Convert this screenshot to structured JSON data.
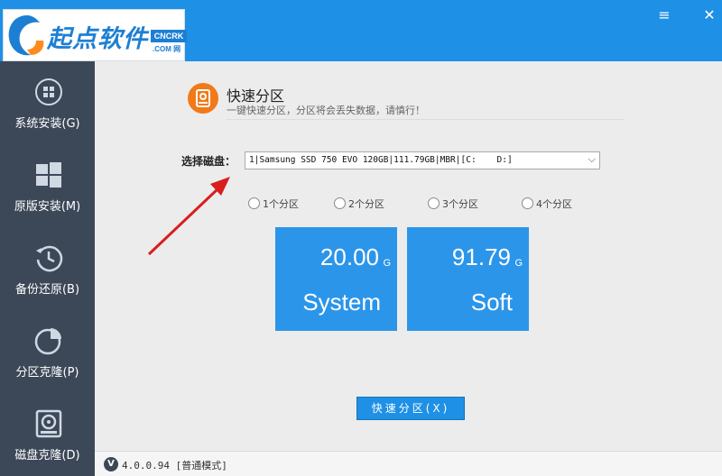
{
  "app": {
    "logo_text": "起点软件",
    "logo_badge": "CNCRK",
    "logo_sub": ".COM 网"
  },
  "window_controls": {
    "menu_icon": "≡",
    "close_icon": "✕"
  },
  "sidebar": {
    "items": [
      {
        "label": "系统安装(G)",
        "icon": "windows-disc-icon"
      },
      {
        "label": "原版安装(M)",
        "icon": "windows-logo-icon"
      },
      {
        "label": "备份还原(B)",
        "icon": "backup-clock-icon"
      },
      {
        "label": "分区克隆(P)",
        "icon": "pie-chart-icon"
      },
      {
        "label": "磁盘克隆(D)",
        "icon": "disk-clone-icon"
      }
    ]
  },
  "header": {
    "title": "快速分区",
    "subtitle": "一键快速分区，分区将会丢失数据，请慎行！"
  },
  "disk": {
    "label": "选择磁盘：",
    "selected": "1|Samsung SSD 750 EVO 120GB|111.79GB|MBR|[C:    D:]"
  },
  "partition_options": [
    {
      "label": "1个分区"
    },
    {
      "label": "2个分区"
    },
    {
      "label": "3个分区"
    },
    {
      "label": "4个分区"
    }
  ],
  "partitions": [
    {
      "size": "20.00",
      "unit": "G",
      "name": "System"
    },
    {
      "size": "91.79",
      "unit": "G",
      "name": "Soft"
    }
  ],
  "action_button": "快速分区(X)",
  "status": {
    "version_badge": "V",
    "version_text": "4.0.0.94 [普通模式]"
  },
  "colors": {
    "titlebar": "#1e90e6",
    "sidebar": "#3c4858",
    "tile": "#2b95ea",
    "accent_orange": "#f07a1a",
    "arrow": "#d81e1e"
  }
}
